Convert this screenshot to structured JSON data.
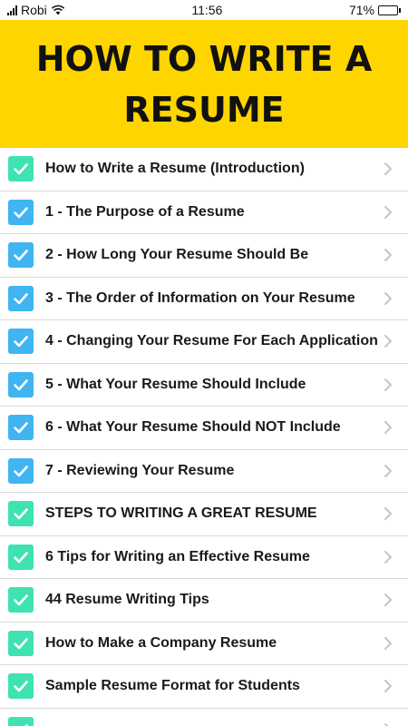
{
  "status_bar": {
    "carrier": "Robi",
    "time": "11:56",
    "battery": "71%",
    "battery_level": 0.71
  },
  "header": {
    "title": "HOW TO WRITE A RESUME",
    "background": "#ffd500"
  },
  "colors": {
    "check_teal": "#3fe2b1",
    "check_blue": "#41b4f2"
  },
  "items": [
    {
      "label": "How to Write a Resume (Introduction)",
      "check": "teal"
    },
    {
      "label": "1 - The Purpose of a Resume",
      "check": "blue"
    },
    {
      "label": "2 - How Long Your Resume Should Be",
      "check": "blue"
    },
    {
      "label": "3 - The Order of Information on Your Resume",
      "check": "blue"
    },
    {
      "label": "4 - Changing Your Resume For Each Application",
      "check": "blue"
    },
    {
      "label": "5 - What Your Resume Should Include",
      "check": "blue"
    },
    {
      "label": "6 - What Your Resume Should NOT Include",
      "check": "blue"
    },
    {
      "label": "7 - Reviewing Your Resume",
      "check": "blue"
    },
    {
      "label": "STEPS TO WRITING A GREAT RESUME",
      "check": "teal"
    },
    {
      "label": "6 Tips for Writing an Effective Resume",
      "check": "teal"
    },
    {
      "label": "44 Resume Writing Tips",
      "check": "teal"
    },
    {
      "label": "How to Make a Company Resume",
      "check": "teal"
    },
    {
      "label": "Sample Resume Format for Students",
      "check": "teal"
    },
    {
      "label": "",
      "check": "teal"
    }
  ]
}
